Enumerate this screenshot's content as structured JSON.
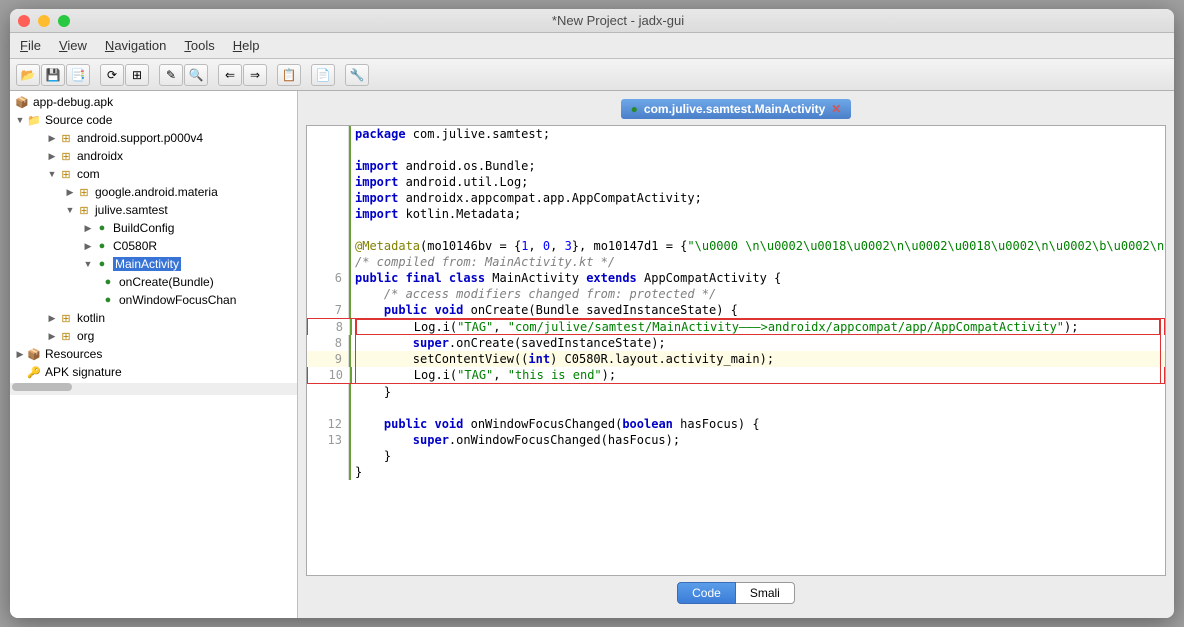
{
  "window": {
    "title": "*New Project - jadx-gui"
  },
  "menu": {
    "file": "File",
    "view": "View",
    "navigation": "Navigation",
    "tools": "Tools",
    "help": "Help"
  },
  "tree": {
    "root": "app-debug.apk",
    "source": "Source code",
    "pkg1": "android.support.p000v4",
    "pkg2": "androidx",
    "pkg3": "com",
    "pkg3a": "google.android.materia",
    "pkg3b": "julive.samtest",
    "cls1": "BuildConfig",
    "cls2": "C0580R",
    "cls3": "MainActivity",
    "m1": "onCreate(Bundle)",
    "m2": "onWindowFocusChan",
    "pkg4": "kotlin",
    "pkg5": "org",
    "res": "Resources",
    "sig": "APK signature"
  },
  "tab": {
    "label": "com.julive.samtest.MainActivity"
  },
  "view": {
    "code": "Code",
    "smali": "Smali"
  },
  "code": {
    "l1": "package com.julive.samtest;",
    "l2": "",
    "l3a": "import",
    "l3b": " android.os.Bundle;",
    "l4a": "import",
    "l4b": " android.util.Log;",
    "l5a": "import",
    "l5b": " androidx.appcompat.app.AppCompatActivity;",
    "l6a": "import",
    "l6b": " kotlin.Metadata;",
    "l7": "",
    "l8": "@Metadata(mo10146bv = {1, 0, 3}, mo10147d1 = {\"\\u0000 \\n\\u0002\\u0018\\u0002\\n\\u0002\\u0018\\u0002\\n\\u0002\\b\\u0002\\n",
    "l9": "/* compiled from: MainActivity.kt */",
    "l10a": "public final class",
    "l10b": " MainActivity ",
    "l10c": "extends",
    "l10d": " AppCompatActivity {",
    "l11": "    /* access modifiers changed from: protected */",
    "l12a": "    public void",
    "l12b": " onCreate(Bundle savedInstanceState) {",
    "l13a": "        Log.i(",
    "l13b": "\"TAG\"",
    "l13c": ", ",
    "l13d": "\"com/julive/samtest/MainActivity———>androidx/appcompat/app/AppCompatActivity\"",
    "l13e": ");",
    "l14a": "        ",
    "l14b": "super",
    "l14c": ".onCreate(savedInstanceState);",
    "l15a": "        setContentView((",
    "l15b": "int",
    "l15c": ") C0580R.layout.activity_main);",
    "l16a": "        Log.i(",
    "l16b": "\"TAG\"",
    "l16c": ", ",
    "l16d": "\"this is end\"",
    "l16e": ");",
    "l17": "    }",
    "l18": "",
    "l19a": "    public void",
    "l19b": " onWindowFocusChanged(",
    "l19c": "boolean",
    "l19d": " hasFocus) {",
    "l20a": "        ",
    "l20b": "super",
    "l20c": ".onWindowFocusChanged(hasFocus);",
    "l21": "    }",
    "l22": "}",
    "ln6": "6",
    "ln7": "7",
    "ln8": "8",
    "ln8b": "8",
    "ln9": "9",
    "ln10": "10",
    "ln12": "12",
    "ln13": "13"
  }
}
